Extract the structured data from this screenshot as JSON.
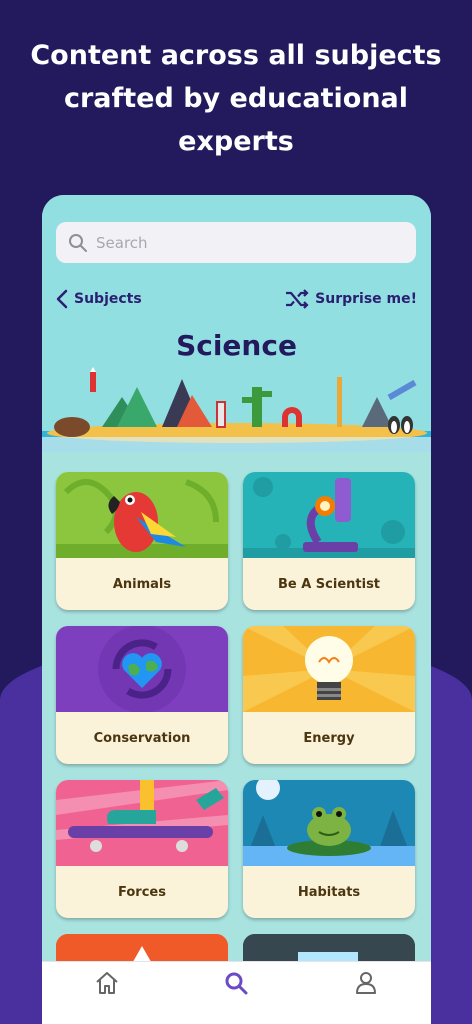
{
  "headline": {
    "line1": "Content across all subjects",
    "line2": "crafted by educational",
    "line3": "experts"
  },
  "search": {
    "placeholder": "Search"
  },
  "nav": {
    "back_label": "Subjects",
    "surprise_label": "Surprise me!"
  },
  "page_title": "Science",
  "topics": [
    {
      "label": "Animals"
    },
    {
      "label": "Be A Scientist"
    },
    {
      "label": "Conservation"
    },
    {
      "label": "Energy"
    },
    {
      "label": "Forces"
    },
    {
      "label": "Habitats"
    }
  ],
  "tabs": [
    {
      "icon": "home-icon"
    },
    {
      "icon": "search-icon",
      "active": true
    },
    {
      "icon": "profile-icon"
    }
  ],
  "colors": {
    "background": "#231a5e",
    "accent": "#6a4bc4",
    "phone_bg": "#a9e3e0",
    "card_label_bg": "#fbf3d9"
  }
}
